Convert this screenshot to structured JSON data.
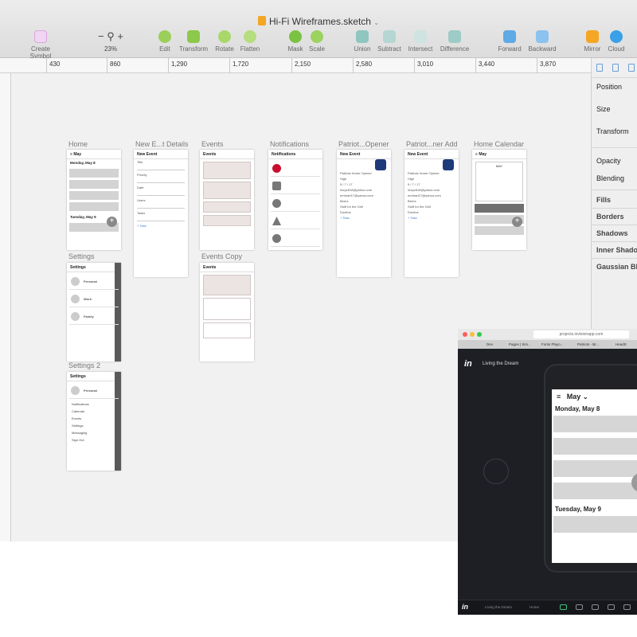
{
  "window": {
    "doc_title": "Hi-Fi Wireframes.sketch"
  },
  "toolbar": {
    "create_symbol": "Create Symbol",
    "zoom_value": "23%",
    "edit": "Edit",
    "transform": "Transform",
    "rotate": "Rotate",
    "flatten": "Flatten",
    "mask": "Mask",
    "scale": "Scale",
    "union": "Union",
    "subtract": "Subtract",
    "intersect": "Intersect",
    "difference": "Difference",
    "forward": "Forward",
    "backward": "Backward",
    "mirror": "Mirror",
    "cloud": "Cloud"
  },
  "ruler": {
    "h_ticks": [
      "430",
      "860",
      "1,290",
      "1,720",
      "2,150",
      "2,580",
      "3,010",
      "3,440",
      "3,870"
    ]
  },
  "inspector": {
    "position": "Position",
    "size": "Size",
    "transform": "Transform",
    "opacity": "Opacity",
    "blending": "Blending",
    "fills": "Fills",
    "borders": "Borders",
    "shadows": "Shadows",
    "inner_shadows": "Inner Shado",
    "gaussian_blur": "Gaussian Blu"
  },
  "artboards": {
    "home": {
      "label": "Home",
      "header": "May",
      "day1": "Monday, May 8",
      "day2": "Tuesday, May 9",
      "fab": "+"
    },
    "new_event": {
      "label": "New E...t Details",
      "header": "New Event",
      "f1": "Title",
      "f2": "Priority",
      "f3": "Date",
      "f4": "Users",
      "f5": "Tasks",
      "add_task": "+ Task"
    },
    "events": {
      "label": "Events",
      "header": "Events"
    },
    "notifications": {
      "label": "Notifications",
      "header": "Notifications"
    },
    "patriot_opener": {
      "label": "Patriot...Opener",
      "header": "New Event",
      "title_val": "Patriots Home Opener",
      "priority": "High",
      "date": "9 / 7 / 17",
      "user": "lizzyz818@yahoo.com",
      "user2": "nrmhart17@yahoo.com",
      "task1": "Beers",
      "task2": "Stuff for the Grill",
      "task3": "Donitos",
      "add_task": "+ Task"
    },
    "patriot_add": {
      "label": "Patriot...ner Add",
      "header": "New Event",
      "title_val": "Patriots Home Opener",
      "priority": "High",
      "date": "9 / 7 / 17",
      "user": "lizzyz818@yahoo.com",
      "user2": "nrmhart17@yahoo.com",
      "task1": "Beers",
      "task2": "Stuff for the Grill",
      "task3": "Donitos",
      "add_task": "+ Task"
    },
    "home_calendar": {
      "label": "Home Calendar",
      "header": "May",
      "month": "MAY"
    },
    "settings": {
      "label": "Settings",
      "header": "Settings",
      "g1": "Personal",
      "g2": "Work",
      "g3": "Family"
    },
    "events_copy": {
      "label": "Events Copy",
      "header": "Events"
    },
    "settings2": {
      "label": "Settings 2",
      "header": "Settings",
      "g1": "Personal",
      "menu": [
        "Notifications",
        "Calendar",
        "Events",
        "Settings",
        "Messaging",
        "Sign Out"
      ]
    }
  },
  "invision": {
    "url": "projects.invisionapp.com",
    "tabs": [
      "Dev",
      "Pages | Sim...",
      "Fonts Playo...",
      "Patriots - Br...",
      "HeadS"
    ],
    "logo": "in",
    "project": "Living the Dream",
    "phone": {
      "month": "May",
      "day1": "Monday, May 8",
      "day2": "Tuesday, May 9",
      "fab": "+"
    },
    "footer": {
      "logo": "in",
      "project": "Living the Dream",
      "mode": "Home"
    }
  }
}
